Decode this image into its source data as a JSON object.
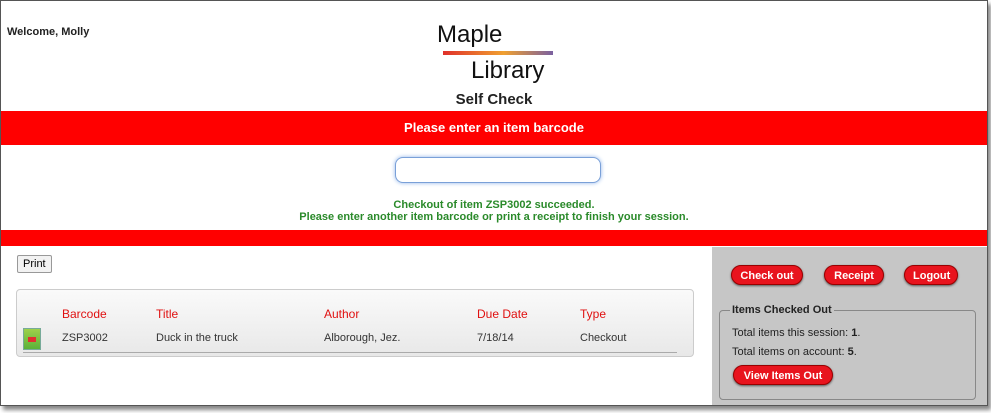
{
  "header": {
    "welcome": "Welcome, Molly",
    "logo_word1": "Maple",
    "logo_word2": "Library",
    "page_title": "Self Check"
  },
  "prompt_banner": "Please enter an item barcode",
  "barcode_input": {
    "value": "",
    "placeholder": ""
  },
  "status": {
    "line1": "Checkout of item ZSP3002 succeeded.",
    "line2": "Please enter another item barcode or print a receipt to finish your session."
  },
  "toolbar": {
    "print_label": "Print"
  },
  "items_table": {
    "columns": [
      "Barcode",
      "Title",
      "Author",
      "Due Date",
      "Type"
    ],
    "rows": [
      {
        "barcode": "ZSP3002",
        "title": "Duck in the truck",
        "author": "Alborough, Jez.",
        "due_date": "7/18/14",
        "type": "Checkout"
      }
    ]
  },
  "sidebar": {
    "checkout_label": "Check out",
    "receipt_label": "Receipt",
    "logout_label": "Logout",
    "items_out_legend": "Items Checked Out",
    "session_prefix": "Total items this session: ",
    "session_count": "1",
    "account_prefix": "Total items on account: ",
    "account_count": "5",
    "period": ".",
    "view_items_label": "View Items Out"
  },
  "colors": {
    "accent": "#ff0000",
    "success": "#2a8a2a",
    "sidebar_bg": "#c6c6c6"
  }
}
